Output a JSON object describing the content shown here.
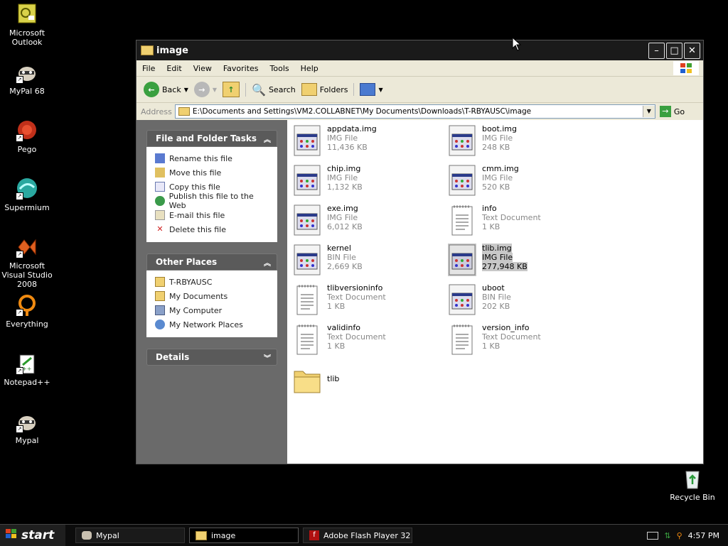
{
  "desktop": {
    "icons": [
      {
        "label": "Microsoft Outlook"
      },
      {
        "label": "MyPal 68"
      },
      {
        "label": "Pego"
      },
      {
        "label": "Supermium"
      },
      {
        "label": "Microsoft Visual Studio 2008"
      },
      {
        "label": "Everything"
      },
      {
        "label": "Notepad++"
      },
      {
        "label": "Mypal"
      },
      {
        "label": "Recycle Bin"
      }
    ]
  },
  "window": {
    "title": "image",
    "menu": [
      "File",
      "Edit",
      "View",
      "Favorites",
      "Tools",
      "Help"
    ],
    "toolbar": {
      "back": "Back",
      "search": "Search",
      "folders": "Folders"
    },
    "address": {
      "label": "Address",
      "path": "E:\\Documents and Settings\\VM2.COLLABNET\\My Documents\\Downloads\\T-RBYAUSC\\image",
      "go": "Go"
    },
    "tasks_panel": {
      "title": "File and Folder Tasks",
      "items": [
        "Rename this file",
        "Move this file",
        "Copy this file",
        "Publish this file to the Web",
        "E-mail this file",
        "Delete this file"
      ]
    },
    "places_panel": {
      "title": "Other Places",
      "items": [
        "T-RBYAUSC",
        "My Documents",
        "My Computer",
        "My Network Places"
      ]
    },
    "details_panel": {
      "title": "Details"
    },
    "files": [
      {
        "name": "appdata.img",
        "type": "IMG File",
        "size": "11,436 KB"
      },
      {
        "name": "boot.img",
        "type": "IMG File",
        "size": "248 KB"
      },
      {
        "name": "chip.img",
        "type": "IMG File",
        "size": "1,132 KB"
      },
      {
        "name": "cmm.img",
        "type": "IMG File",
        "size": "520 KB"
      },
      {
        "name": "exe.img",
        "type": "IMG File",
        "size": "6,012 KB"
      },
      {
        "name": "info",
        "type": "Text Document",
        "size": "1 KB"
      },
      {
        "name": "kernel",
        "type": "BIN File",
        "size": "2,669 KB"
      },
      {
        "name": "tlib.img",
        "type": "IMG File",
        "size": "277,948 KB"
      },
      {
        "name": "tlibversioninfo",
        "type": "Text Document",
        "size": "1 KB"
      },
      {
        "name": "uboot",
        "type": "BIN File",
        "size": "202 KB"
      },
      {
        "name": "validinfo",
        "type": "Text Document",
        "size": "1 KB"
      },
      {
        "name": "version_info",
        "type": "Text Document",
        "size": "1 KB"
      },
      {
        "name": "tlib",
        "type": "",
        "size": ""
      }
    ]
  },
  "taskbar": {
    "start": "start",
    "buttons": [
      "Mypal",
      "image",
      "Adobe Flash Player 32"
    ],
    "clock": "4:57 PM"
  }
}
